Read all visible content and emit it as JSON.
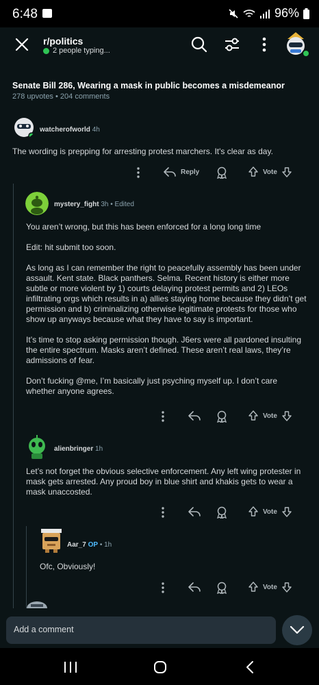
{
  "status_bar": {
    "time": "6:48",
    "battery": "96%"
  },
  "header": {
    "subreddit": "r/politics",
    "typing_status": "2 people typing..."
  },
  "post": {
    "title": "Senate Bill 286, Wearing a mask in public becomes a misdemeanor",
    "upvotes": "278 upvotes",
    "comments": "204 comments"
  },
  "comments": [
    {
      "author": "watcherofworld",
      "time": "4h",
      "paragraphs": [
        "The wording is prepping for arresting protest marchers. It's clear as day."
      ],
      "reply_label": "Reply",
      "vote_label": "Vote"
    },
    {
      "author": "mystery_fight",
      "time": "3h",
      "edited": "Edited",
      "paragraphs": [
        "You aren’t wrong, but this has been enforced for a long long time",
        "Edit: hit submit too soon.",
        "As long as I can remember the right to peacefully assembly has been under assault. Kent state. Black panthers. Selma. Recent history is either more subtle or more violent by 1) courts delaying protest permits and 2) LEOs infiltrating orgs which results in a) allies staying home because they didn’t get permission and b) criminalizing otherwise legitimate protests for those who show up anyways because what they have to say is important.",
        "It’s time to stop asking permission though. J6ers were all pardoned insulting the entire spectrum. Masks aren’t defined. These aren’t real laws, they’re admissions of fear.",
        "Don’t fucking @me, I’m basically just psyching myself up. I don’t care whether anyone agrees."
      ],
      "vote_label": "Vote"
    },
    {
      "author": "alienbringer",
      "time": "1h",
      "paragraphs": [
        "Let’s not forget the obvious selective enforcement. Any left wing protester in mask gets arrested. Any proud boy in blue shirt and khakis gets to wear a mask unaccosted."
      ],
      "vote_label": "Vote"
    },
    {
      "author": "Aar_7",
      "op_badge": "OP",
      "time": "1h",
      "paragraphs": [
        "Ofc, Obviously!"
      ],
      "vote_label": "Vote"
    }
  ],
  "bottom": {
    "comment_placeholder": "Add a comment"
  },
  "icons": {
    "close": "close-icon",
    "search": "search-icon",
    "filter": "filter-icon",
    "more": "more-vertical-icon",
    "reply": "reply-arrow-icon",
    "award": "award-icon",
    "upvote": "upvote-icon",
    "downvote": "downvote-icon",
    "chevron": "chevron-down-icon"
  },
  "colors": {
    "background": "#0b1416",
    "online": "#2fc455",
    "op": "#4fbcff",
    "text": "#d7dadc",
    "muted": "#8ba2ad"
  }
}
